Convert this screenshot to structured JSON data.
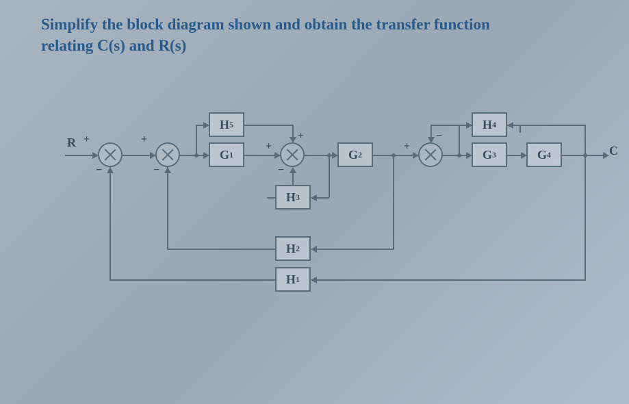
{
  "title_line1": "Simplify the block diagram shown and obtain the transfer function",
  "title_line2": "relating C(s) and R(s)",
  "labels": {
    "R": "R",
    "C": "C"
  },
  "blocks": {
    "H5": "H",
    "H5_sub": "5",
    "G1": "G",
    "G1_sub": "1",
    "G2": "G",
    "G2_sub": "2",
    "H4": "H",
    "H4_sub": "4",
    "G3": "G",
    "G3_sub": "3",
    "G4": "G",
    "G4_sub": "4",
    "H3": "H",
    "H3_sub": "3",
    "H2": "H",
    "H2_sub": "2",
    "H1": "H",
    "H1_sub": "1"
  },
  "signs": {
    "plus": "+",
    "minus": "−"
  }
}
